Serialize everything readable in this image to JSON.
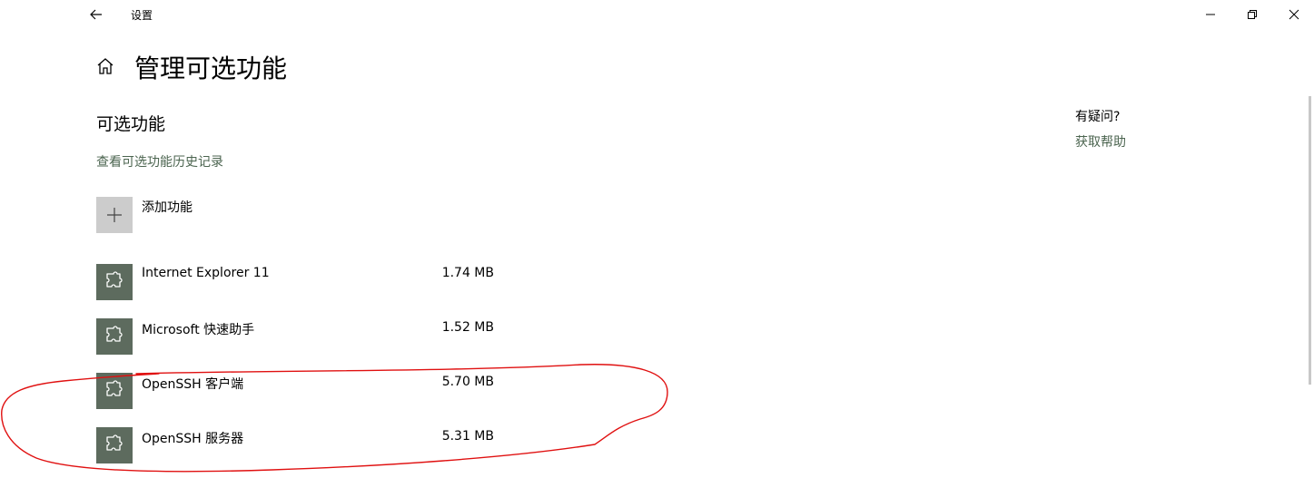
{
  "window": {
    "title": "设置",
    "back_icon": "arrow-left-icon",
    "controls": [
      "minimize-icon",
      "restore-icon",
      "close-icon"
    ]
  },
  "header": {
    "home_icon": "home-icon",
    "title": "管理可选功能"
  },
  "section": {
    "title": "可选功能",
    "history_link": "查看可选功能历史记录",
    "add_feature_label": "添加功能"
  },
  "features": [
    {
      "name": "Internet Explorer 11",
      "size": "1.74 MB",
      "icon": "puzzle-icon"
    },
    {
      "name": "Microsoft 快速助手",
      "size": "1.52 MB",
      "icon": "puzzle-icon"
    },
    {
      "name": "OpenSSH 客户端",
      "size": "5.70 MB",
      "icon": "puzzle-icon"
    },
    {
      "name": "OpenSSH 服务器",
      "size": "5.31 MB",
      "icon": "puzzle-icon"
    }
  ],
  "help": {
    "title": "有疑问?",
    "link": "获取帮助"
  },
  "colors": {
    "accent_link": "#4c6550",
    "feature_tile": "#5d6b5e",
    "add_tile": "#cccccc",
    "annotation": "#e01010"
  }
}
